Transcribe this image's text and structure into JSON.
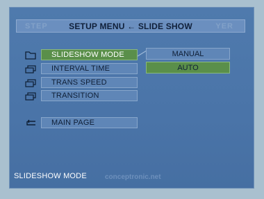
{
  "title": "SETUP MENU ← SLIDE SHOW",
  "watermark": {
    "left": "STEP",
    "right": "YER",
    "bottom": "conceptronic.net"
  },
  "menu": {
    "items": [
      {
        "label": "SLIDESHOW MODE",
        "icon": "folder-icon",
        "selected": true
      },
      {
        "label": "INTERVAL TIME",
        "icon": "stack-icon",
        "selected": false
      },
      {
        "label": "TRANS SPEED",
        "icon": "stack-icon",
        "selected": false
      },
      {
        "label": "TRANSITION",
        "icon": "stack-icon",
        "selected": false
      }
    ],
    "back": {
      "label": "MAIN PAGE",
      "icon": "return-icon"
    }
  },
  "options": [
    {
      "label": "MANUAL",
      "selected": false
    },
    {
      "label": "AUTO",
      "selected": true
    }
  ],
  "status": "SLIDESHOW MODE",
  "colors": {
    "background": "#4a74a8",
    "selected": "#5a8f4a",
    "item": "#5f86b7"
  }
}
